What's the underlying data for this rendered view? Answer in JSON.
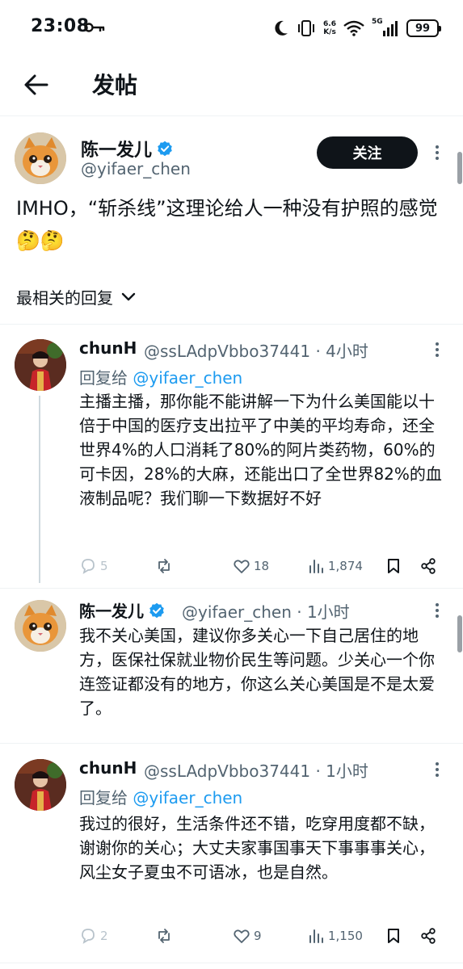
{
  "status_bar": {
    "time": "23:08",
    "net_speed_top": "6.6",
    "net_speed_bottom": "K/s",
    "signal_label": "5G",
    "battery": "99"
  },
  "header": {
    "title": "发帖",
    "back_icon": "arrow-left-icon"
  },
  "post": {
    "author_name": "陈一发儿",
    "author_handle": "@yifaer_chen",
    "follow_label": "关注",
    "text": "IMHO，“斩杀线”这理论给人一种没有护照的感觉🤔🤔"
  },
  "sort": {
    "label": "最相关的回复"
  },
  "replies": [
    {
      "name": "chunH",
      "meta": "@ssLAdpVbbo37441 · 4小时",
      "reply_prefix": "回复给",
      "reply_to": "@yifaer_chen",
      "text": "主播主播，那你能不能讲解一下为什么美国能以十倍于中国的医疗支出拉平了中美的平均寿命，还全世界4%的人口消耗了80%的阿片类药物，60%的可卡因，28%的大麻，还能出口了全世界82%的血液制品呢？我们聊一下数据好不好",
      "comments": "5",
      "likes": "18",
      "views": "1,874"
    },
    {
      "name": "陈一发儿",
      "meta": "@yifaer_chen · 1小时",
      "text": "我不关心美国，建议你多关心一下自己居住的地方，医保社保就业物价民生等问题。少关心一个你连签证都没有的地方，你这么关心美国是不是太爱了。"
    },
    {
      "name": "chunH",
      "meta": "@ssLAdpVbbo37441 · 1小时",
      "reply_prefix": "回复给",
      "reply_to": "@yifaer_chen",
      "text": "我过的很好，生活条件还不错，吃穿用度都不缺，谢谢你的关心；大丈夫家事国事天下事事事关心，风尘女子夏虫不可语冰，也是自然。",
      "comments": "2",
      "likes": "9",
      "views": "1,150"
    }
  ],
  "colors": {
    "accent": "#1d9bf0",
    "secondary_text": "#536471",
    "primary_text": "#0f1419"
  }
}
